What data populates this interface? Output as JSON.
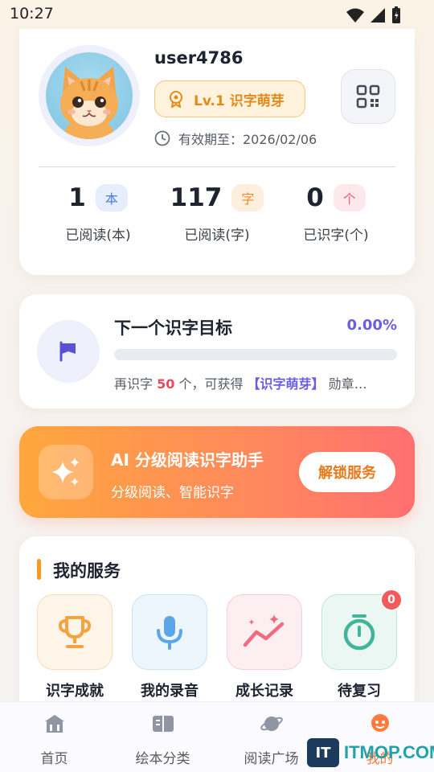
{
  "status_bar": {
    "time": "10:27"
  },
  "profile": {
    "username": "user4786",
    "level_label": "Lv.1 识字萌芽",
    "expiry_label": "有效期至：2026/02/06",
    "stats": [
      {
        "value": "1",
        "tag": "本",
        "label": "已阅读(本)",
        "tag_color": "#4b7de0",
        "tag_bg": "#e6eefc"
      },
      {
        "value": "117",
        "tag": "字",
        "label": "已阅读(字)",
        "tag_color": "#ef8a26",
        "tag_bg": "#fdeedd"
      },
      {
        "value": "0",
        "tag": "个",
        "label": "已识字(个)",
        "tag_color": "#e8607a",
        "tag_bg": "#fde8ec"
      }
    ]
  },
  "goal": {
    "title": "下一个识字目标",
    "percent": "0.00%",
    "progress_fraction": 0.0,
    "note_prefix": "再识字 ",
    "note_count": "50",
    "note_mid": " 个，可获得 ",
    "note_badge": "【识字萌芽】",
    "note_suffix": " 勋章…"
  },
  "ai_banner": {
    "title": "AI 分级阅读识字助手",
    "subtitle": "分级阅读、智能识字",
    "button_label": "解锁服务"
  },
  "services": {
    "title": "我的服务",
    "items": [
      {
        "label": "识字成就",
        "icon": "trophy-icon",
        "color": "#f5a340",
        "bg": "#fff4e8",
        "border": "#f8dcb8"
      },
      {
        "label": "我的录音",
        "icon": "microphone-icon",
        "color": "#5aa6e8",
        "bg": "#eef6fd",
        "border": "#c9e2f7"
      },
      {
        "label": "成长记录",
        "icon": "growth-chart-icon",
        "color": "#ef6b7d",
        "bg": "#fdeff1",
        "border": "#f6cfd5"
      },
      {
        "label": "待复习",
        "icon": "stopwatch-icon",
        "color": "#3fb59a",
        "bg": "#eaf7f3",
        "border": "#bfe6db",
        "badge": "0"
      }
    ]
  },
  "bottom_nav": {
    "items": [
      {
        "label": "首页",
        "icon": "home-icon"
      },
      {
        "label": "绘本分类",
        "icon": "book-icon"
      },
      {
        "label": "阅读广场",
        "icon": "planet-icon"
      },
      {
        "label": "我的",
        "icon": "profile-icon"
      }
    ]
  },
  "watermark": {
    "logo": "IT",
    "text": "ITMOP.COM"
  }
}
